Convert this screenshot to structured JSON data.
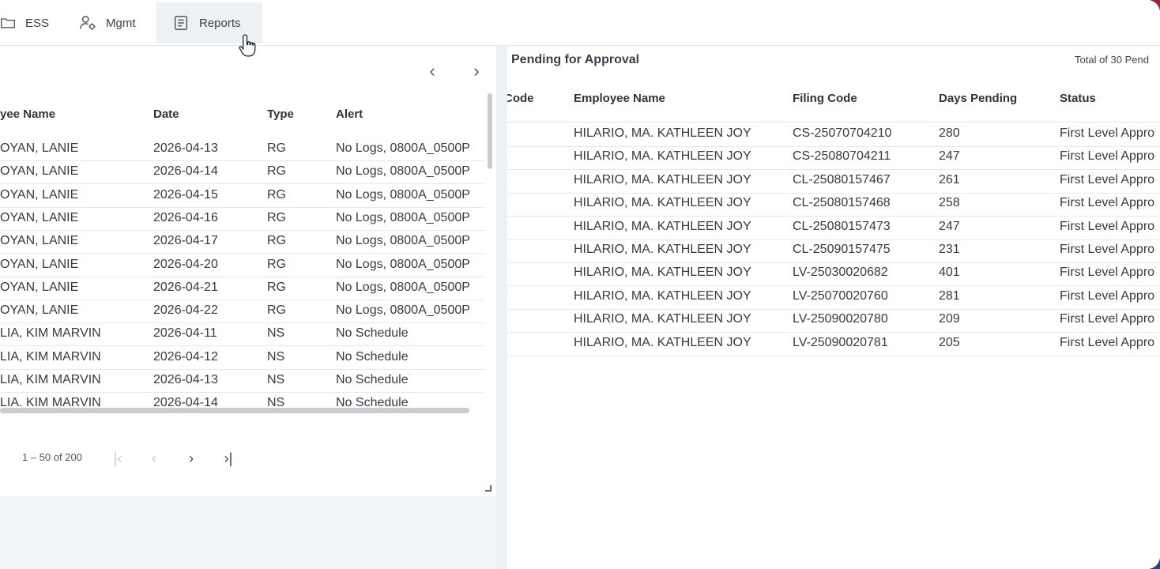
{
  "nav": {
    "items": [
      {
        "label": "ESS",
        "icon": "folder-icon"
      },
      {
        "label": "Mgmt",
        "icon": "user-settings-icon"
      },
      {
        "label": "Reports",
        "icon": "document-icon",
        "active": true
      }
    ]
  },
  "left_table": {
    "columns": [
      "yee Name",
      "Date",
      "Type",
      "Alert"
    ],
    "rows": [
      [
        "OYAN, LANIE",
        "2026-04-13",
        "RG",
        "No Logs, 0800A_0500P"
      ],
      [
        "OYAN, LANIE",
        "2026-04-14",
        "RG",
        "No Logs, 0800A_0500P"
      ],
      [
        "OYAN, LANIE",
        "2026-04-15",
        "RG",
        "No Logs, 0800A_0500P"
      ],
      [
        "OYAN, LANIE",
        "2026-04-16",
        "RG",
        "No Logs, 0800A_0500P"
      ],
      [
        "OYAN, LANIE",
        "2026-04-17",
        "RG",
        "No Logs, 0800A_0500P"
      ],
      [
        "OYAN, LANIE",
        "2026-04-20",
        "RG",
        "No Logs, 0800A_0500P"
      ],
      [
        "OYAN, LANIE",
        "2026-04-21",
        "RG",
        "No Logs, 0800A_0500P"
      ],
      [
        "OYAN, LANIE",
        "2026-04-22",
        "RG",
        "No Logs, 0800A_0500P"
      ],
      [
        "LIA, KIM MARVIN",
        "2026-04-11",
        "NS",
        "No Schedule"
      ],
      [
        "LIA, KIM MARVIN",
        "2026-04-12",
        "NS",
        "No Schedule"
      ],
      [
        "LIA, KIM MARVIN",
        "2026-04-13",
        "NS",
        "No Schedule"
      ],
      [
        "LIA, KIM MARVIN",
        "2026-04-14",
        "NS",
        "No Schedule"
      ]
    ],
    "pager_text": "1 – 50 of 200"
  },
  "right_table": {
    "title": "Pending for Approval",
    "total": "Total of 30 Pend",
    "columns": [
      "Code",
      "Employee Name",
      "Filing Code",
      "Days Pending",
      "Status"
    ],
    "rows": [
      [
        "HILARIO, MA. KATHLEEN JOY",
        "CS-25070704210",
        "280",
        "First Level Appro"
      ],
      [
        "HILARIO, MA. KATHLEEN JOY",
        "CS-25080704211",
        "247",
        "First Level Appro"
      ],
      [
        "HILARIO, MA. KATHLEEN JOY",
        "CL-25080157467",
        "261",
        "First Level Appro"
      ],
      [
        "HILARIO, MA. KATHLEEN JOY",
        "CL-25080157468",
        "258",
        "First Level Appro"
      ],
      [
        "HILARIO, MA. KATHLEEN JOY",
        "CL-25080157473",
        "247",
        "First Level Appro"
      ],
      [
        "HILARIO, MA. KATHLEEN JOY",
        "CL-25090157475",
        "231",
        "First Level Appro"
      ],
      [
        "HILARIO, MA. KATHLEEN JOY",
        "LV-25030020682",
        "401",
        "First Level Appro"
      ],
      [
        "HILARIO, MA. KATHLEEN JOY",
        "LV-25070020760",
        "281",
        "First Level Appro"
      ],
      [
        "HILARIO, MA. KATHLEEN JOY",
        "LV-25090020780",
        "209",
        "First Level Appro"
      ],
      [
        "HILARIO, MA. KATHLEEN JOY",
        "LV-25090020781",
        "205",
        "First Level Appro"
      ]
    ]
  },
  "colors": {
    "nav_active_bg": "#eef1f4",
    "panel_bg": "#f2f5f8",
    "frame_gradient_top": "#9a2336",
    "frame_gradient_bottom": "#1b3fb0"
  }
}
